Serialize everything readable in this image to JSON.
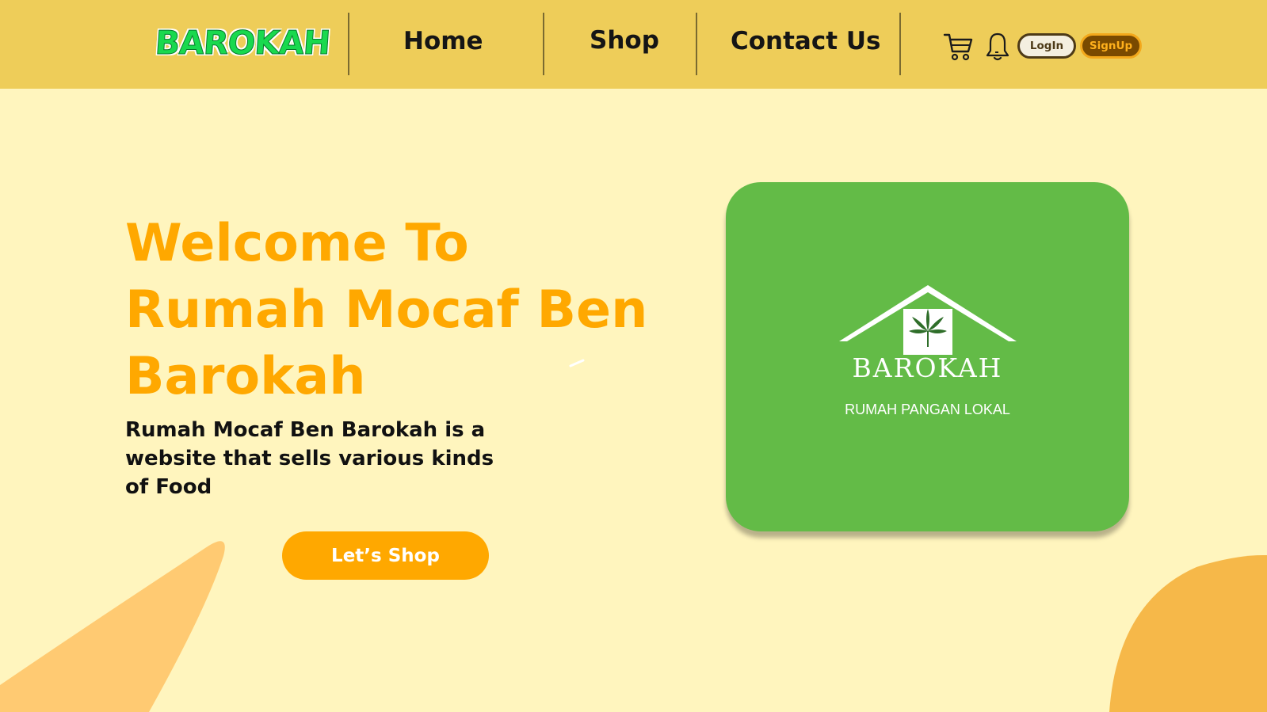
{
  "header": {
    "brand": "BAROKAH",
    "nav": {
      "home": "Home",
      "shop": "Shop",
      "contact": "Contact Us"
    },
    "icons": {
      "cart": "cart-icon",
      "notifications": "bell-icon"
    },
    "login_label": "LogIn",
    "signup_label": "SignUp"
  },
  "hero": {
    "title": "Welcome To\nRumah Mocaf Ben\nBarokah",
    "description": "Rumah Mocaf Ben Barokah is a website that sells various kinds of Food",
    "cta_label": "Let’s Shop"
  },
  "logo_card": {
    "brand": "BAROKAH",
    "tagline": "RUMAH PANGAN LOKAL",
    "icon": "house-leaf-icon"
  },
  "colors": {
    "header_bg": "#EECD59",
    "page_bg": "#FFF5BE",
    "accent": "#FFA800",
    "card_bg": "#63BB47",
    "brand_green": "#19D94E"
  }
}
